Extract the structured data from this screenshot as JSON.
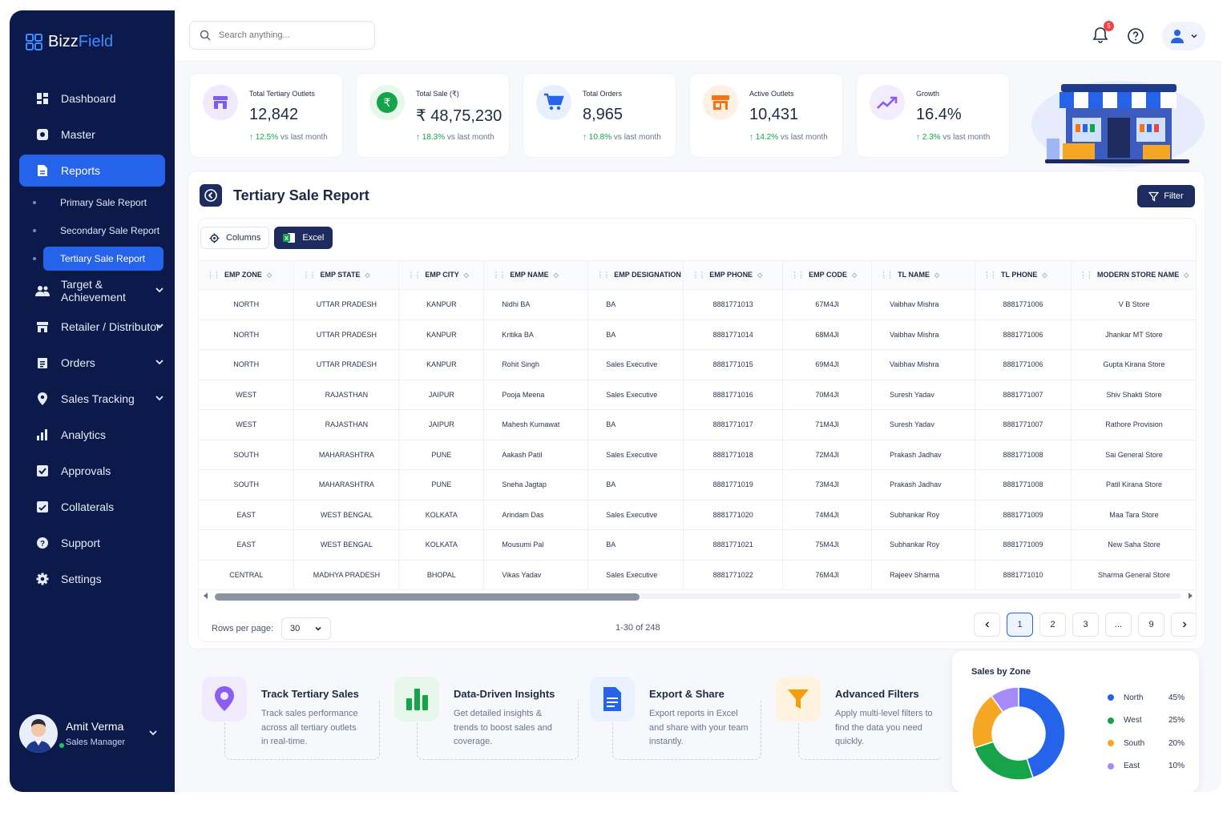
{
  "app": {
    "brand_part1": "Bizz",
    "brand_part2": "Field"
  },
  "sidebar": {
    "items": [
      {
        "label": "Dashboard",
        "icon": "dashboard-icon"
      },
      {
        "label": "Master",
        "icon": "gear-box-icon"
      },
      {
        "label": "Reports",
        "icon": "file-icon",
        "active": true
      },
      {
        "label": "Target & Achievement",
        "icon": "users-icon"
      },
      {
        "label": "Retailer / Distributor",
        "icon": "store-icon"
      },
      {
        "label": "Orders",
        "icon": "clipboard-icon"
      },
      {
        "label": "Sales Tracking",
        "icon": "location-pin-icon"
      },
      {
        "label": "Analytics",
        "icon": "bar-chart-icon"
      },
      {
        "label": "Approvals",
        "icon": "check-square-icon"
      },
      {
        "label": "Collaterals",
        "icon": "document-check-icon"
      },
      {
        "label": "Support",
        "icon": "help-circle-icon"
      },
      {
        "label": "Settings",
        "icon": "gear-icon"
      }
    ],
    "report_sub": [
      "Primary Sale Report",
      "Secondary Sale Report",
      "Tertiary Sale Report"
    ]
  },
  "user": {
    "name": "Amit Verma",
    "role": "Sales Manager"
  },
  "topbar": {
    "search_placeholder": "Search anything...",
    "notification_count": "5"
  },
  "stats": [
    {
      "label": "Total Tertiary Outlets",
      "value": "12,842",
      "change": "12.5%",
      "suffix": "vs last month",
      "color": "#7c5cf5",
      "bg": "#efeafe"
    },
    {
      "label": "Total Sale (₹)",
      "value": "₹ 48,75,230",
      "change": "18.3%",
      "suffix": "vs last month",
      "color": "#16a34a",
      "bg": "#e6f7ec"
    },
    {
      "label": "Total Orders",
      "value": "8,965",
      "change": "10.8%",
      "suffix": "vs last month",
      "color": "#2563eb",
      "bg": "#e8efff"
    },
    {
      "label": "Active Outlets",
      "value": "10,431",
      "change": "14.2%",
      "suffix": "vs last month",
      "color": "#f97316",
      "bg": "#fff0e3"
    },
    {
      "label": "Growth",
      "value": "16.4%",
      "change": "2.3%",
      "suffix": "vs last month",
      "color": "#8b5cf6",
      "bg": "#f2ecfe"
    }
  ],
  "report": {
    "title": "Tertiary Sale Report",
    "filter_label": "Filter",
    "columns_label": "Columns",
    "excel_label": "Excel",
    "headers": [
      "EMP ZONE",
      "EMP STATE",
      "EMP CITY",
      "EMP NAME",
      "EMP DESIGNATION",
      "EMP PHONE",
      "EMP CODE",
      "TL NAME",
      "TL PHONE",
      "MODERN STORE NAME"
    ],
    "rows": [
      [
        "NORTH",
        "UTTAR PRADESH",
        "KANPUR",
        "Nidhi BA",
        "BA",
        "8881771013",
        "67M4JI",
        "Vaibhav Mishra",
        "8881771006",
        "V B Store"
      ],
      [
        "NORTH",
        "UTTAR PRADESH",
        "KANPUR",
        "Kritika BA",
        "BA",
        "8881771014",
        "68M4JI",
        "Vaibhav Mishra",
        "8881771006",
        "Jhankar MT Store"
      ],
      [
        "NORTH",
        "UTTAR PRADESH",
        "KANPUR",
        "Rohit Singh",
        "Sales Executive",
        "8881771015",
        "69M4JI",
        "Vaibhav Mishra",
        "8881771006",
        "Gupta Kirana Store"
      ],
      [
        "WEST",
        "RAJASTHAN",
        "JAIPUR",
        "Pooja Meena",
        "Sales Executive",
        "8881771016",
        "70M4JI",
        "Suresh Yadav",
        "8881771007",
        "Shiv Shakti Store"
      ],
      [
        "WEST",
        "RAJASTHAN",
        "JAIPUR",
        "Mahesh Kumawat",
        "BA",
        "8881771017",
        "71M4JI",
        "Suresh Yadav",
        "8881771007",
        "Rathore Provision"
      ],
      [
        "SOUTH",
        "MAHARASHTRA",
        "PUNE",
        "Aakash Patil",
        "Sales Executive",
        "8881771018",
        "72M4JI",
        "Prakash Jadhav",
        "8881771008",
        "Sai General Store"
      ],
      [
        "SOUTH",
        "MAHARASHTRA",
        "PUNE",
        "Sneha Jagtap",
        "BA",
        "8881771019",
        "73M4JI",
        "Prakash Jadhav",
        "8881771008",
        "Patil Kirana Store"
      ],
      [
        "EAST",
        "WEST BENGAL",
        "KOLKATA",
        "Arindam Das",
        "Sales Executive",
        "8881771020",
        "74M4JI",
        "Subhankar Roy",
        "8881771009",
        "Maa Tara Store"
      ],
      [
        "EAST",
        "WEST BENGAL",
        "KOLKATA",
        "Mousumi Pal",
        "BA",
        "8881771021",
        "75M4JI",
        "Subhankar Roy",
        "8881771009",
        "New Saha Store"
      ],
      [
        "CENTRAL",
        "MADHYA PRADESH",
        "BHOPAL",
        "Vikas Yadav",
        "Sales Executive",
        "8881771022",
        "76M4JI",
        "Rajeev Sharma",
        "8881771010",
        "Sharma General Store"
      ]
    ],
    "rows_per_page_label": "Rows per page:",
    "rows_per_page": "30",
    "range": "1-30 of 248",
    "pages": [
      "1",
      "2",
      "3",
      "...",
      "9"
    ]
  },
  "features": [
    {
      "title": "Track Tertiary Sales",
      "desc": "Track sales performance across all tertiary outlets in real-time.",
      "color": "#8b5cf6",
      "bg": "#f1ebfe"
    },
    {
      "title": "Data-Driven Insights",
      "desc": "Get detailed insights & trends to boost sales and coverage.",
      "color": "#16a34a",
      "bg": "#e7f7ec"
    },
    {
      "title": "Export & Share",
      "desc": "Export reports in Excel and share with your team instantly.",
      "color": "#2563eb",
      "bg": "#e9f0ff"
    },
    {
      "title": "Advanced Filters",
      "desc": "Apply multi-level filters to find the data you need quickly.",
      "color": "#f59e0b",
      "bg": "#fff3df"
    }
  ],
  "chart_data": {
    "type": "pie",
    "title": "Sales by Zone",
    "categories": [
      "North",
      "West",
      "South",
      "East"
    ],
    "values": [
      45,
      25,
      20,
      10
    ],
    "value_labels": [
      "45%",
      "25%",
      "20%",
      "10%"
    ],
    "colors": [
      "#2563eb",
      "#16a34a",
      "#f5a623",
      "#a78bfa"
    ],
    "donut": true,
    "legend": "right"
  }
}
